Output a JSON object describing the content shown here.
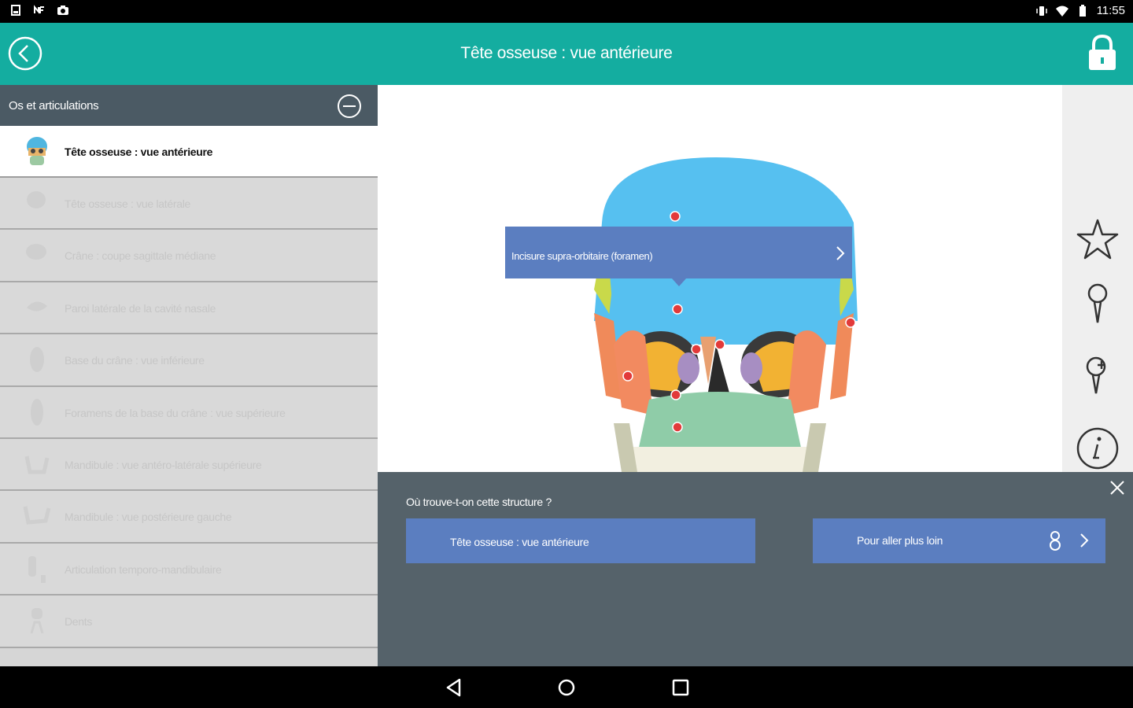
{
  "status_bar": {
    "time": "11:55",
    "left_icons": [
      "sd-card-icon",
      "nfc-icon",
      "camera-icon"
    ],
    "right_icons": [
      "vibrate-icon",
      "wifi-icon",
      "battery-icon"
    ]
  },
  "app_bar": {
    "title": "Tête osseuse : vue antérieure",
    "icons": [
      "back-arrow-icon",
      "lock-icon"
    ]
  },
  "sidebar": {
    "header": "Os et articulations",
    "items": [
      {
        "label": "Tête osseuse : vue antérieure",
        "active": true
      },
      {
        "label": "Tête osseuse : vue latérale",
        "active": false
      },
      {
        "label": "Crâne : coupe sagittale médiane",
        "active": false
      },
      {
        "label": "Paroi latérale de la cavité nasale",
        "active": false
      },
      {
        "label": "Base du crâne : vue inférieure",
        "active": false
      },
      {
        "label": "Foramens de la base du crâne : vue supérieure",
        "active": false
      },
      {
        "label": "Mandibule : vue antéro-latérale supérieure",
        "active": false
      },
      {
        "label": "Mandibule : vue postérieure gauche",
        "active": false
      },
      {
        "label": "Articulation temporo-mandibulaire",
        "active": false
      },
      {
        "label": "Dents",
        "active": false
      }
    ]
  },
  "viewer": {
    "tooltip_label": "Incisure supra-orbitaire (foramen)",
    "tool_icons": [
      "star-icon",
      "pin-icon",
      "pin-add-icon",
      "info-icon"
    ]
  },
  "panel": {
    "question": "Où trouve-t-on cette structure ?",
    "button_location": "Tête osseuse : vue antérieure",
    "button_more": "Pour aller plus loin"
  },
  "nav_bar": {
    "icons": [
      "nav-back-icon",
      "nav-home-icon",
      "nav-recents-icon"
    ]
  },
  "colors": {
    "app_bar": "#14ada0",
    "sidebar_header": "#4b5a64",
    "accent_button": "#5b7ec0",
    "panel": "#4e5c64"
  }
}
